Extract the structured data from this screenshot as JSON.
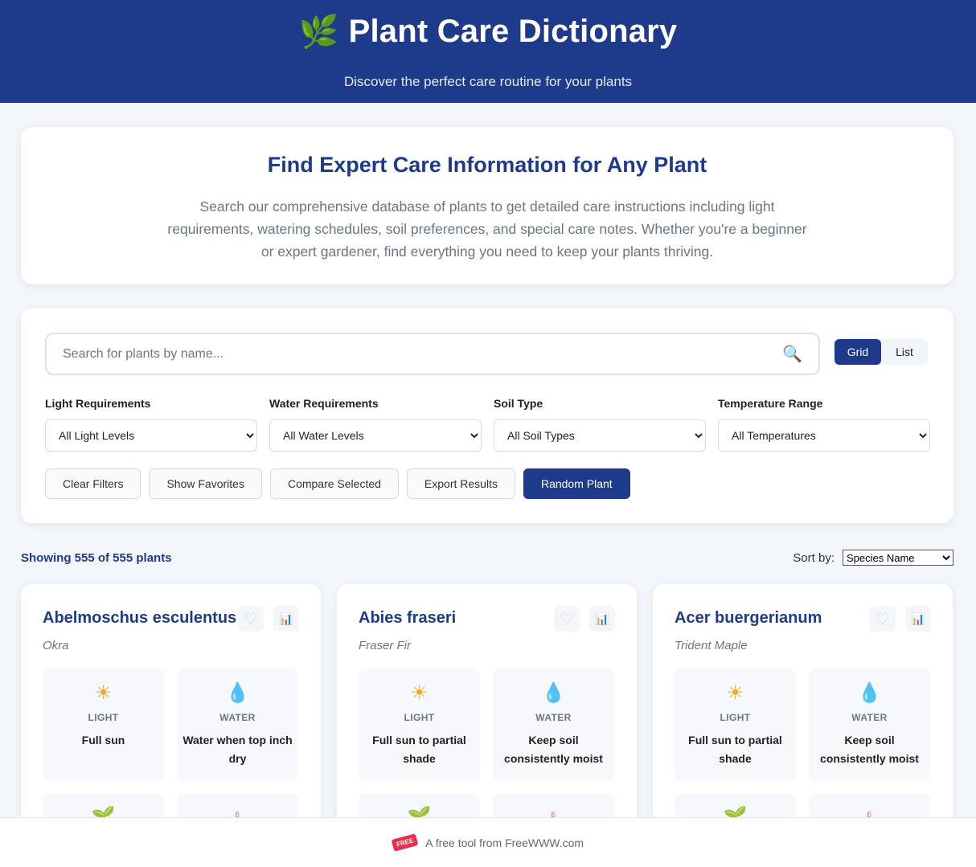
{
  "header": {
    "icon": "leaf-icon",
    "title": "Plant Care Dictionary",
    "subtitle": "Discover the perfect care routine for your plants"
  },
  "intro": {
    "title": "Find Expert Care Information for Any Plant",
    "text": "Search our comprehensive database of plants to get detailed care instructions including light requirements, watering schedules, soil preferences, and special care notes. Whether you're a beginner or expert gardener, find everything you need to keep your plants thriving."
  },
  "search": {
    "placeholder": "Search for plants by name...",
    "value": ""
  },
  "view_toggle": {
    "grid": "Grid",
    "list": "List",
    "active": "grid"
  },
  "filters": [
    {
      "label": "Light Requirements",
      "selected": "All Light Levels"
    },
    {
      "label": "Water Requirements",
      "selected": "All Water Levels"
    },
    {
      "label": "Soil Type",
      "selected": "All Soil Types"
    },
    {
      "label": "Temperature Range",
      "selected": "All Temperatures"
    }
  ],
  "actions": {
    "clear": "Clear Filters",
    "favorites": "Show Favorites",
    "compare": "Compare Selected",
    "export": "Export Results",
    "random": "Random Plant"
  },
  "results": {
    "count_text": "Showing 555 of 555 plants",
    "sort_label": "Sort by:",
    "sort_selected": "Species Name"
  },
  "care_labels": {
    "light": "LIGHT",
    "water": "WATER"
  },
  "plants": [
    {
      "name": "Abelmoschus esculentus",
      "common": "Okra",
      "light": "Full sun",
      "water": "Water when top inch dry"
    },
    {
      "name": "Abies fraseri",
      "common": "Fraser Fir",
      "light": "Full sun to partial shade",
      "water": "Keep soil consistently moist"
    },
    {
      "name": "Acer buergerianum",
      "common": "Trident Maple",
      "light": "Full sun to partial shade",
      "water": "Keep soil consistently moist"
    }
  ],
  "footer": {
    "badge": "FREE",
    "text": "A free tool from FreeWWW.com"
  },
  "colors": {
    "brand": "#1e3a8a",
    "background": "#f3f6fa"
  }
}
